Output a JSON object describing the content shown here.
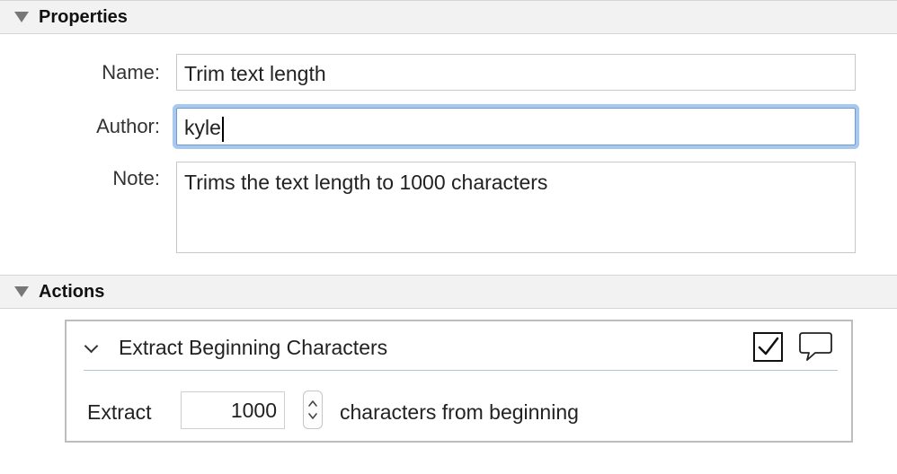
{
  "properties": {
    "section_title": "Properties",
    "name_label": "Name:",
    "name_value": "Trim text length",
    "author_label": "Author:",
    "author_value": "kyle",
    "note_label": "Note:",
    "note_value": "Trims the text length to 1000 characters"
  },
  "actions": {
    "section_title": "Actions",
    "items": [
      {
        "title": "Extract Beginning Characters",
        "enabled": true,
        "prefix_label": "Extract",
        "count_value": "1000",
        "suffix_label": "characters from beginning"
      }
    ]
  },
  "colors": {
    "focus_ring": "#a9c8f0",
    "divider": "#a9c9d6",
    "header_bg": "#f2f2f2"
  }
}
